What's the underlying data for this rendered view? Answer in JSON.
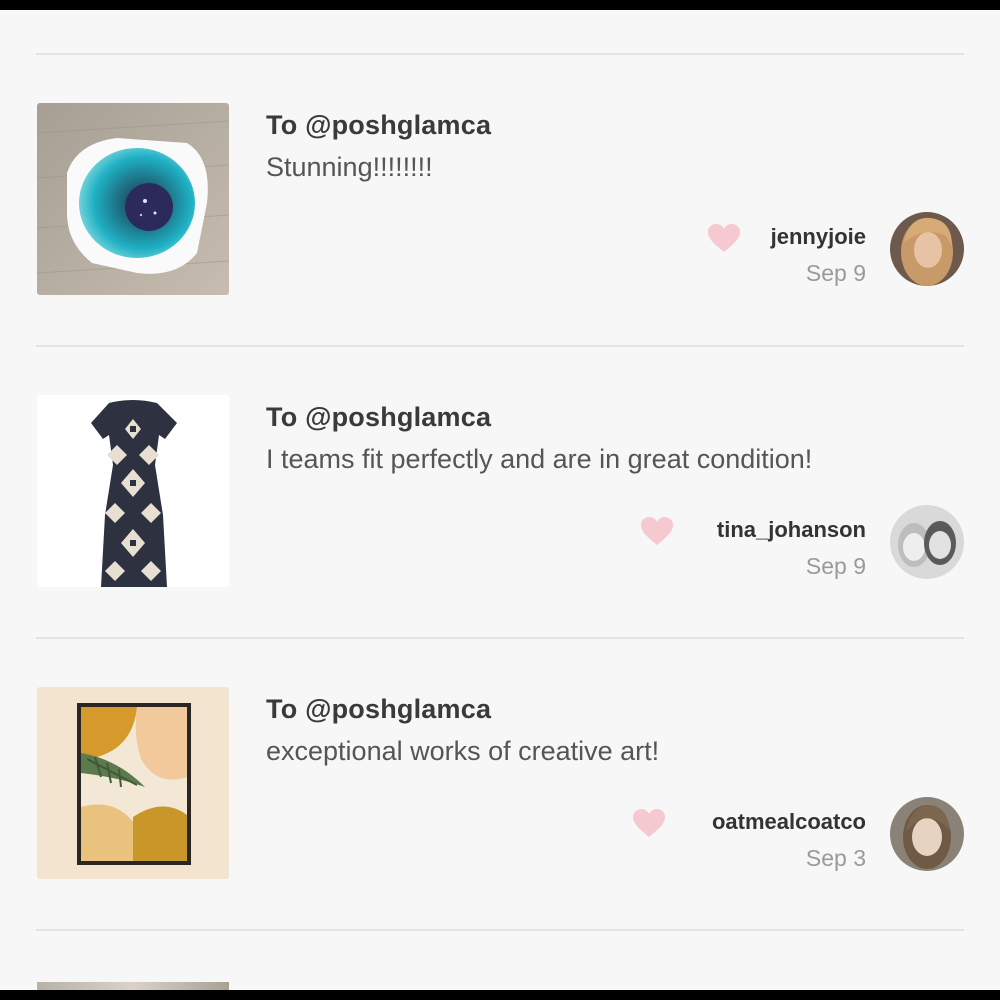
{
  "reviews": [
    {
      "to": "To @poshglamca",
      "message": "Stunning!!!!!!!!",
      "username": "jennyjoie",
      "date": "Sep 9",
      "thumbnail_icon": "bowl-photo",
      "avatar_icon": "user-avatar"
    },
    {
      "to": "To @poshglamca",
      "message": "I teams fit perfectly and are in great condition!",
      "username": "tina_johanson",
      "date": "Sep 9",
      "thumbnail_icon": "dress-photo",
      "avatar_icon": "user-avatar"
    },
    {
      "to": "To @poshglamca",
      "message": "exceptional works of creative art!",
      "username": "oatmealcoatco",
      "date": "Sep 3",
      "thumbnail_icon": "art-print-photo",
      "avatar_icon": "user-avatar"
    }
  ],
  "colors": {
    "heart": "#f6c9d0",
    "divider": "#e2e2e4",
    "background": "#f7f7f8"
  }
}
